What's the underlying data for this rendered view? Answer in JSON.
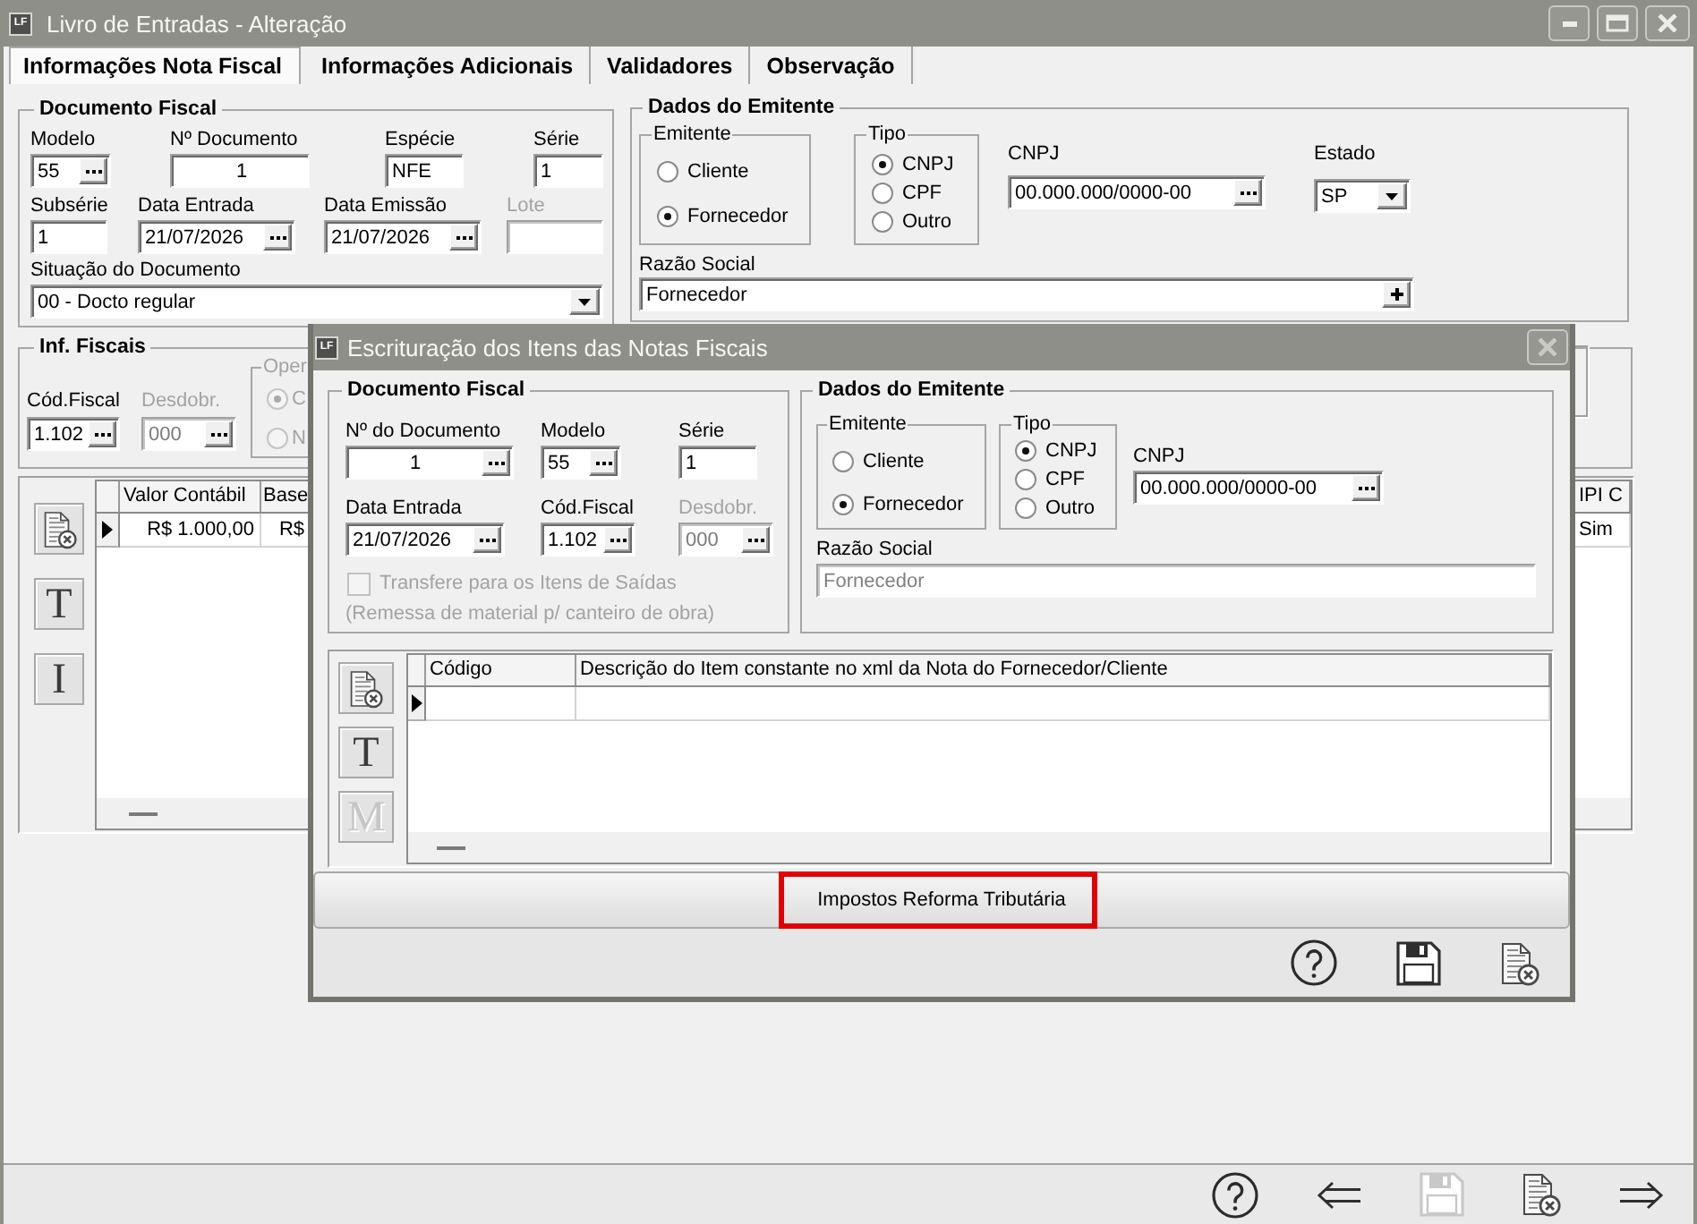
{
  "window": {
    "logo": "LF",
    "title": "Livro de Entradas - Alteração"
  },
  "tabs": [
    {
      "label": "Informações Nota Fiscal",
      "selected": true
    },
    {
      "label": "Informações Adicionais",
      "selected": false
    },
    {
      "label": "Validadores",
      "selected": false
    },
    {
      "label": "Observação",
      "selected": false
    }
  ],
  "documento_fiscal": {
    "title": "Documento Fiscal",
    "rows": [
      [
        {
          "label": "Modelo",
          "value": "55",
          "kind": "lookup",
          "disabled": false
        },
        {
          "label": "Nº Documento",
          "value": "1",
          "kind": "text",
          "disabled": false
        },
        {
          "label": "Espécie",
          "value": "NFE",
          "kind": "text",
          "disabled": false
        },
        {
          "label": "Série",
          "value": "1",
          "kind": "text",
          "disabled": false
        }
      ],
      [
        {
          "label": "Subsérie",
          "value": "1",
          "kind": "text",
          "disabled": false
        },
        {
          "label": "Data Entrada",
          "value": "21/07/2026",
          "kind": "lookup",
          "disabled": false
        },
        {
          "label": "Data Emissão",
          "value": "21/07/2026",
          "kind": "lookup",
          "disabled": false
        },
        {
          "label": "Lote",
          "kind": "text",
          "disabled": true
        }
      ],
      [
        {
          "label": "Situação do Documento",
          "value": "00 - Docto regular",
          "kind": "dropdown",
          "disabled": false
        }
      ]
    ]
  },
  "dados_emitente": {
    "title": "Dados do Emitente",
    "emitente": {
      "title": "Emitente",
      "options": [
        {
          "label": "Cliente",
          "selected": false
        },
        {
          "label": "Fornecedor",
          "selected": true
        }
      ]
    },
    "tipo": {
      "title": "Tipo",
      "options": [
        {
          "label": "CNPJ",
          "selected": true
        },
        {
          "label": "CPF",
          "selected": false
        },
        {
          "label": "Outro",
          "selected": false
        }
      ]
    },
    "fields": [
      {
        "label": "CNPJ",
        "value": "00.000.000/0000-00",
        "kind": "lookup",
        "disabled": false
      },
      {
        "label": "Estado",
        "value": "SP",
        "kind": "dropdown",
        "disabled": false
      }
    ],
    "razao_social": {
      "label": "Razão Social",
      "value": "Fornecedor",
      "kind": "add",
      "disabled": false
    }
  },
  "inf_fiscais": {
    "title": "Inf. Fiscais",
    "fields": [
      {
        "label": "Cód.Fiscal",
        "value": "1.102",
        "kind": "lookup",
        "disabled": false
      },
      {
        "label": "Desdobr.",
        "value": "000",
        "kind": "lookup",
        "disabled": true
      }
    ],
    "operacao": {
      "title": "Oper",
      "disabled": true,
      "options": [
        {
          "label": "C",
          "selected": true
        },
        {
          "label": "N",
          "selected": false
        }
      ]
    }
  },
  "grid": {
    "side_buttons": [
      {
        "kind": "delete",
        "disabled": false
      },
      {
        "kind": "letter",
        "label": "T",
        "disabled": false
      },
      {
        "kind": "letter",
        "label": "I",
        "disabled": false
      }
    ],
    "columns": [
      "Valor Contábil",
      "Base",
      "IPI C"
    ],
    "rows": [
      {
        "current": true,
        "cells": [
          "R$ 1.000,00",
          "R$",
          "Sim"
        ]
      }
    ]
  },
  "toolbar": [
    {
      "kind": "help",
      "disabled": false
    },
    {
      "kind": "back",
      "disabled": false
    },
    {
      "kind": "save",
      "disabled": true
    },
    {
      "kind": "delete",
      "disabled": false
    },
    {
      "kind": "forward",
      "disabled": false
    }
  ],
  "dialog": {
    "logo": "LF",
    "title": "Escrituração dos Itens das Notas Fiscais",
    "documento_fiscal": {
      "title": "Documento Fiscal",
      "rows": [
        [
          {
            "label": "Nº do Documento",
            "value": "1",
            "kind": "lookup",
            "disabled": false
          },
          {
            "label": "Modelo",
            "value": "55",
            "kind": "lookup",
            "disabled": false
          },
          {
            "label": "Série",
            "value": "1",
            "kind": "text",
            "disabled": false
          }
        ],
        [
          {
            "label": "Data Entrada",
            "value": "21/07/2026",
            "kind": "lookup",
            "disabled": false
          },
          {
            "label": "Cód.Fiscal",
            "value": "1.102",
            "kind": "lookup",
            "disabled": false
          },
          {
            "label": "Desdobr.",
            "value": "000",
            "kind": "lookup",
            "disabled": true
          }
        ]
      ],
      "transfer": {
        "label": "Transfere para os Itens de Saídas",
        "checked": false,
        "disabled": true
      },
      "note": "(Remessa de material p/ canteiro de obra)"
    },
    "dados_emitente": {
      "title": "Dados do Emitente",
      "emitente": {
        "title": "Emitente",
        "options": [
          {
            "label": "Cliente",
            "selected": false
          },
          {
            "label": "Fornecedor",
            "selected": true
          }
        ]
      },
      "tipo": {
        "title": "Tipo",
        "options": [
          {
            "label": "CNPJ",
            "selected": true
          },
          {
            "label": "CPF",
            "selected": false
          },
          {
            "label": "Outro",
            "selected": false
          }
        ]
      },
      "fields": [
        {
          "label": "CNPJ",
          "value": "00.000.000/0000-00",
          "kind": "lookup",
          "disabled": false
        }
      ],
      "razao_social": {
        "label": "Razão Social",
        "value": "Fornecedor",
        "readonly": true
      }
    },
    "grid": {
      "side_buttons": [
        {
          "kind": "delete",
          "disabled": false
        },
        {
          "kind": "letter",
          "label": "T",
          "disabled": false
        },
        {
          "kind": "letter",
          "label": "M",
          "disabled": true
        }
      ],
      "columns": [
        "Código",
        "Descrição do Item constante no xml da Nota do Fornecedor/Cliente"
      ],
      "rows": [
        {
          "current": true
        }
      ]
    },
    "action_button": {
      "label": "Impostos Reforma Tributária",
      "highlighted": true
    },
    "toolbar": [
      {
        "kind": "help",
        "disabled": false
      },
      {
        "kind": "save",
        "disabled": false
      },
      {
        "kind": "delete",
        "disabled": false
      }
    ]
  }
}
